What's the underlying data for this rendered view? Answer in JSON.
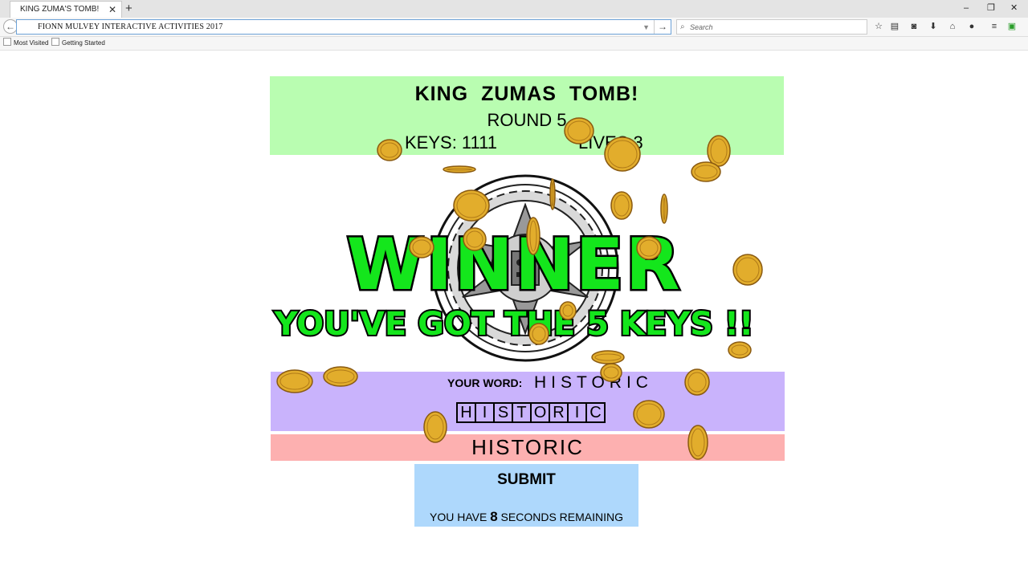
{
  "browser": {
    "tab_title": "KING ZUMA'S TOMB!",
    "url_text": "FIONN MULVEY    INTERACTIVE ACTIVITIES 2017",
    "search_placeholder": "Search",
    "bookmarks": [
      "Most Visited",
      "Getting Started"
    ]
  },
  "game": {
    "title": "KING ZUMAS TOMB!",
    "round": "ROUND 5",
    "keys": "KEYS: 1111",
    "lives": "LIVES 3",
    "your_word_label": "YOUR WORD:",
    "your_word": "HISTORIC",
    "letters": [
      "H",
      "I",
      "S",
      "T",
      "O",
      "R",
      "I",
      "C"
    ],
    "guess_value": "HISTORIC",
    "submit_label": "SUBMIT",
    "timer_prefix": "YOU HAVE",
    "timer_seconds": "8",
    "timer_suffix": "SECONDS REMAINING",
    "winner_text": "WINNER",
    "winner_subtext": "YOU'VE GOT THE 5 KEYS !!"
  },
  "colors": {
    "header_bg": "#b9fdb1",
    "word_bg": "#c9b3fc",
    "guess_bg": "#fdb0b0",
    "submit_bg": "#aed8fc",
    "winner_green": "#14e61c",
    "coin_gold": "#e2ad2c"
  },
  "icons": [
    "back-arrow-icon",
    "go-arrow-icon",
    "search-icon",
    "star-icon",
    "reading-list-icon",
    "pocket-icon",
    "download-icon",
    "home-icon",
    "chat-icon",
    "menu-icon",
    "extension-icon",
    "coin-icon"
  ]
}
